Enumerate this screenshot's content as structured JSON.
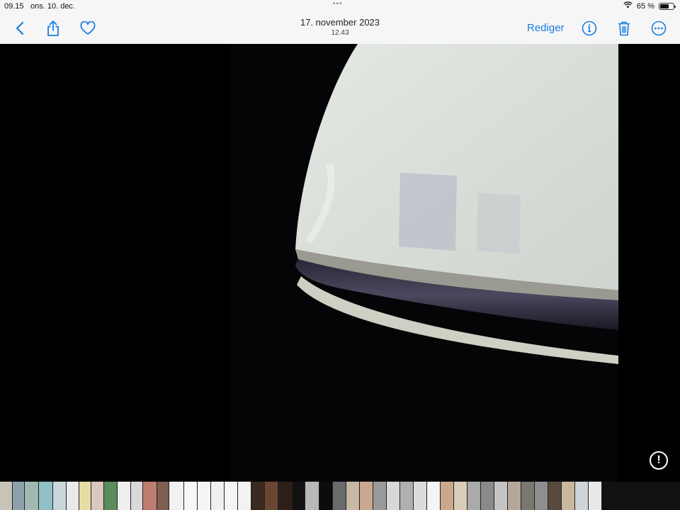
{
  "status": {
    "time": "09.15",
    "date": "ons. 10. dec.",
    "dots": "•••",
    "battery_pct": "65 %",
    "battery_level": 0.65
  },
  "nav": {
    "title_date": "17. november 2023",
    "title_time": "12.43",
    "edit_label": "Rediger"
  },
  "colors": {
    "accent": "#1a7de0",
    "bar_bg": "#f6f6f6"
  },
  "icons": [
    "back-chevron-icon",
    "share-icon",
    "heart-icon",
    "info-icon",
    "trash-icon",
    "more-icon",
    "warning-icon",
    "wifi-icon"
  ],
  "filmstrip": [
    {
      "w": 18,
      "c": "#c9c3b7"
    },
    {
      "w": 17,
      "c": "#8fa0ad"
    },
    {
      "w": 20,
      "c": "#9fb9b0"
    },
    {
      "w": 20,
      "c": "#8fc0c6"
    },
    {
      "w": 19,
      "c": "#c8d6dc"
    },
    {
      "w": 18,
      "c": "#e9e9e9"
    },
    {
      "w": 17,
      "c": "#e6dca6"
    },
    {
      "w": 18,
      "c": "#d8c8c0"
    },
    {
      "w": 19,
      "c": "#5a8c5c"
    },
    {
      "w": 19,
      "c": "#eeeeee"
    },
    {
      "w": 17,
      "c": "#d9d9d9"
    },
    {
      "w": 20,
      "c": "#bd7d6f"
    },
    {
      "w": 17,
      "c": "#7f5f4f"
    },
    {
      "w": 21,
      "c": "#f1f1f1"
    },
    {
      "w": 19,
      "c": "#f7f7f7"
    },
    {
      "w": 19,
      "c": "#f4f4f4"
    },
    {
      "w": 19,
      "c": "#f0f0f0"
    },
    {
      "w": 19,
      "c": "#f5f5f5"
    },
    {
      "w": 19,
      "c": "#f2f2f2"
    },
    {
      "w": 19,
      "c": "#3a2a22"
    },
    {
      "w": 19,
      "c": "#6a4632"
    },
    {
      "w": 20,
      "c": "#2e1e18"
    },
    {
      "w": 18,
      "c": "#111111"
    },
    {
      "w": 20,
      "c": "#b8b8b8"
    },
    {
      "w": 19,
      "c": "#0c0c0c"
    },
    {
      "w": 19,
      "c": "#6a6a6a"
    },
    {
      "w": 19,
      "c": "#c6b8a4"
    },
    {
      "w": 19,
      "c": "#caa890"
    },
    {
      "w": 19,
      "c": "#9a9a9a"
    },
    {
      "w": 19,
      "c": "#d8d8d8"
    },
    {
      "w": 19,
      "c": "#b0b0b0"
    },
    {
      "w": 19,
      "c": "#dcdcdc"
    },
    {
      "w": 19,
      "c": "#f4f4f4"
    },
    {
      "w": 19,
      "c": "#c9a98a"
    },
    {
      "w": 19,
      "c": "#d8cdb8"
    },
    {
      "w": 19,
      "c": "#a9a9a9"
    },
    {
      "w": 19,
      "c": "#8a8a8a"
    },
    {
      "w": 19,
      "c": "#c4c4c4"
    },
    {
      "w": 19,
      "c": "#b2a79a"
    },
    {
      "w": 19,
      "c": "#7a7670"
    },
    {
      "w": 19,
      "c": "#8e8e8e"
    },
    {
      "w": 19,
      "c": "#5a4a3e"
    },
    {
      "w": 19,
      "c": "#c8b89e"
    },
    {
      "w": 19,
      "c": "#cdd4da"
    },
    {
      "w": 19,
      "c": "#e8e8e8"
    }
  ]
}
